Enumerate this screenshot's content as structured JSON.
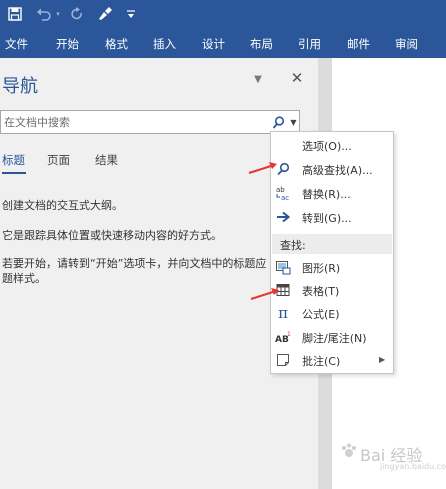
{
  "quick_access": {
    "save": "save-icon",
    "undo": "undo-icon",
    "redo": "redo-icon",
    "format_painter": "format-painter-icon",
    "customize": "customize-dropdown-icon"
  },
  "ribbon": {
    "tabs": [
      {
        "label": "文件"
      },
      {
        "label": "开始"
      },
      {
        "label": "格式"
      },
      {
        "label": "插入"
      },
      {
        "label": "设计"
      },
      {
        "label": "布局"
      },
      {
        "label": "引用"
      },
      {
        "label": "邮件"
      },
      {
        "label": "审阅"
      }
    ]
  },
  "nav_pane": {
    "title": "导航",
    "search_placeholder": "在文档中搜索",
    "tabs": [
      {
        "label": "标题",
        "active": true
      },
      {
        "label": "页面",
        "active": false
      },
      {
        "label": "结果",
        "active": false
      }
    ],
    "lines": [
      "创建文档的交互式大纲。",
      "它是跟踪具体位置或快速移动内容的好方式。",
      "若要开始，请转到“开始”选项卡，并向文档中的标题应",
      "题样式。"
    ]
  },
  "search_menu": {
    "items": [
      {
        "label": "选项(O)...",
        "icon": "none"
      },
      {
        "label": "高级查找(A)...",
        "icon": "magnifier-icon"
      },
      {
        "label": "替换(R)...",
        "icon": "replace-icon"
      },
      {
        "label": "转到(G)...",
        "icon": "goto-arrow-icon"
      }
    ],
    "section_header": "查找:",
    "find_items": [
      {
        "label": "图形(R)",
        "icon": "graphic-icon"
      },
      {
        "label": "表格(T)",
        "icon": "table-icon"
      },
      {
        "label": "公式(E)",
        "icon": "pi-icon"
      },
      {
        "label": "脚注/尾注(N)",
        "icon": "footnote-icon"
      },
      {
        "label": "批注(C)",
        "icon": "comment-icon",
        "submenu": true
      }
    ]
  },
  "watermark": {
    "text": "Bai 经验",
    "sub": "jingyan.baidu.com"
  },
  "colors": {
    "ribbon": "#2b579a",
    "accent": "#2b579a",
    "annotation_arrow": "#e8352c"
  }
}
